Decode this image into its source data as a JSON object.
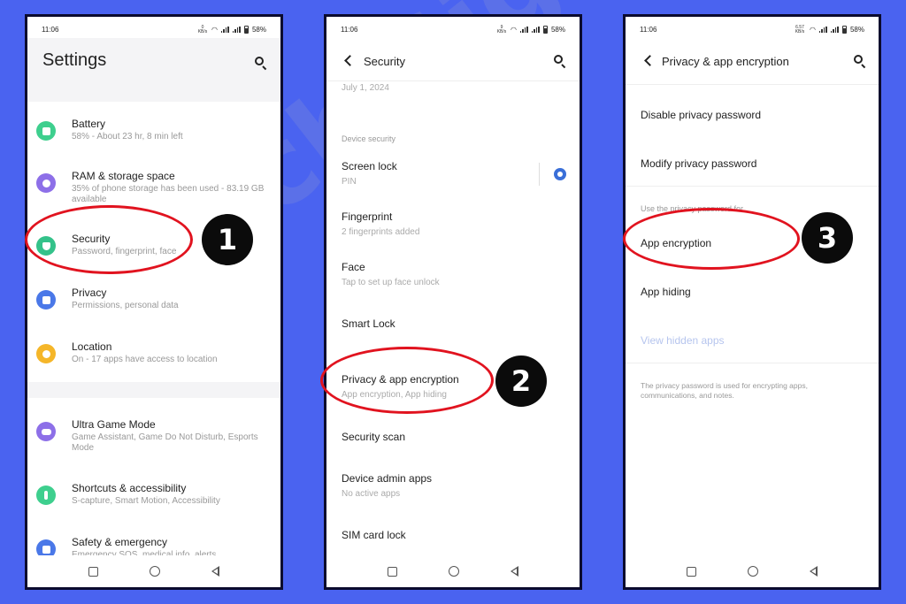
{
  "status": {
    "time": "11:06",
    "battery": "58%",
    "net_speed_1": "0 KB/s",
    "net_speed_2": "9 KB/s",
    "net_speed_3": "6.57 KB/s"
  },
  "phone1": {
    "title": "Settings",
    "items": [
      {
        "label": "Battery",
        "sub": "58% - About 23 hr, 8 min left",
        "color": "#3ecf8e"
      },
      {
        "label": "RAM & storage space",
        "sub": "35% of phone storage has been used - 83.19 GB available",
        "color": "#8d6fe8"
      },
      {
        "label": "Security",
        "sub": "Password, fingerprint, face",
        "color": "#34c28a"
      },
      {
        "label": "Privacy",
        "sub": "Permissions, personal data",
        "color": "#4a78e8"
      },
      {
        "label": "Location",
        "sub": "On - 17 apps have access to location",
        "color": "#f5b629"
      },
      {
        "label": "Ultra Game Mode",
        "sub": "Game Assistant, Game Do Not Disturb, Esports Mode",
        "color": "#8d6fe8"
      },
      {
        "label": "Shortcuts & accessibility",
        "sub": "S-capture, Smart Motion, Accessibility",
        "color": "#3ecf8e"
      },
      {
        "label": "Safety & emergency",
        "sub": "Emergency SOS, medical info, alerts",
        "color": "#4a78e8"
      }
    ]
  },
  "phone2": {
    "title": "Security",
    "date": "July 1, 2024",
    "section": "Device security",
    "items": [
      {
        "label": "Screen lock",
        "sub": "PIN"
      },
      {
        "label": "Fingerprint",
        "sub": "2 fingerprints added"
      },
      {
        "label": "Face",
        "sub": "Tap to set up face unlock"
      },
      {
        "label": "Smart Lock",
        "sub": ""
      },
      {
        "label": "Privacy & app encryption",
        "sub": "App encryption, App hiding"
      },
      {
        "label": "Security scan",
        "sub": ""
      },
      {
        "label": "Device admin apps",
        "sub": "No active apps"
      },
      {
        "label": "SIM card lock",
        "sub": ""
      }
    ]
  },
  "phone3": {
    "title": "Privacy & app encryption",
    "items": [
      {
        "label": "Disable privacy password"
      },
      {
        "label": "Modify privacy password"
      }
    ],
    "section": "Use the privacy password for",
    "items2": [
      {
        "label": "App encryption"
      },
      {
        "label": "App hiding"
      },
      {
        "label": "View hidden apps"
      }
    ],
    "footer": "The privacy password is used for encrypting apps, communications, and notes."
  },
  "badges": [
    "1",
    "2",
    "3"
  ],
  "watermark": "Tech Signal",
  "colors": {
    "background": "#4a63f0",
    "highlight": "#e1131f",
    "accent": "#3a6fd8"
  }
}
